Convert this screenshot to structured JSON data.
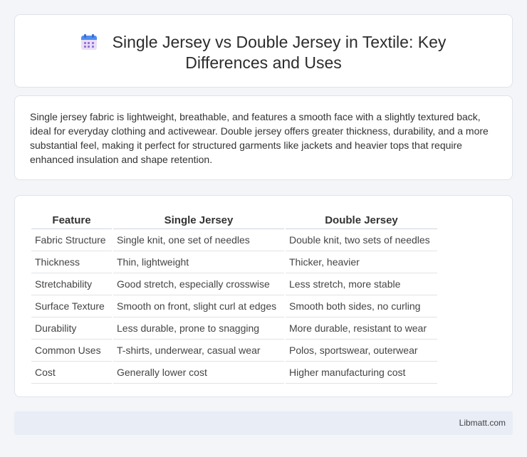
{
  "header": {
    "icon": "calendar-icon",
    "title": "Single Jersey vs Double Jersey in Textile: Key Differences and Uses"
  },
  "description": "Single jersey fabric is lightweight, breathable, and features a smooth face with a slightly textured back, ideal for everyday clothing and activewear. Double jersey offers greater thickness, durability, and a more substantial feel, making it perfect for structured garments like jackets and heavier tops that require enhanced insulation and shape retention.",
  "table": {
    "headers": [
      "Feature",
      "Single Jersey",
      "Double Jersey"
    ],
    "rows": [
      [
        "Fabric Structure",
        "Single knit, one set of needles",
        "Double knit, two sets of needles"
      ],
      [
        "Thickness",
        "Thin, lightweight",
        "Thicker, heavier"
      ],
      [
        "Stretchability",
        "Good stretch, especially crosswise",
        "Less stretch, more stable"
      ],
      [
        "Surface Texture",
        "Smooth on front, slight curl at edges",
        "Smooth both sides, no curling"
      ],
      [
        "Durability",
        "Less durable, prone to snagging",
        "More durable, resistant to wear"
      ],
      [
        "Common Uses",
        "T-shirts, underwear, casual wear",
        "Polos, sportswear, outerwear"
      ],
      [
        "Cost",
        "Generally lower cost",
        "Higher manufacturing cost"
      ]
    ]
  },
  "footer": {
    "brand": "Libmatt.com"
  },
  "colors": {
    "background": "#f3f5f9",
    "card": "#ffffff",
    "footer": "#e8edf6",
    "icon_accent": "#4f8ef0"
  }
}
